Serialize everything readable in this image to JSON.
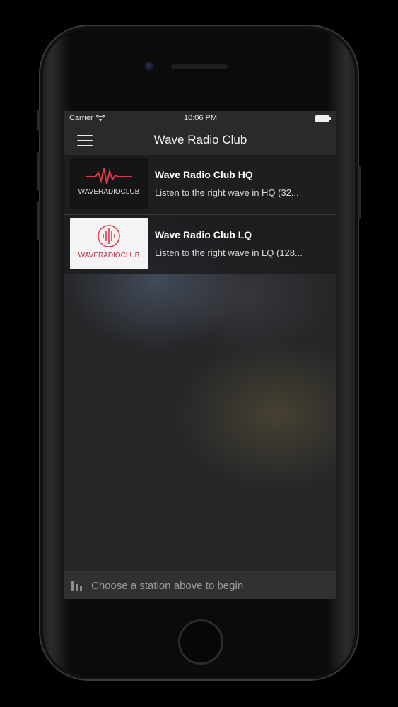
{
  "status": {
    "carrier": "Carrier",
    "time": "10:06 PM"
  },
  "nav": {
    "title": "Wave Radio Club",
    "menu_icon": "hamburger-icon"
  },
  "stations": [
    {
      "name": "Wave Radio Club HQ",
      "description": "Listen to the right wave in HQ (32...",
      "logo_text": "WAVERADIOCLUB"
    },
    {
      "name": "Wave Radio Club LQ",
      "description": "Listen to the right wave in LQ (128...",
      "logo_text": "WAVERADIOCLUB"
    }
  ],
  "player": {
    "icon": "equalizer-icon",
    "prompt": "Choose a station above to begin"
  },
  "colors": {
    "accent": "#e0374a",
    "bar": "#2a2a2c"
  }
}
